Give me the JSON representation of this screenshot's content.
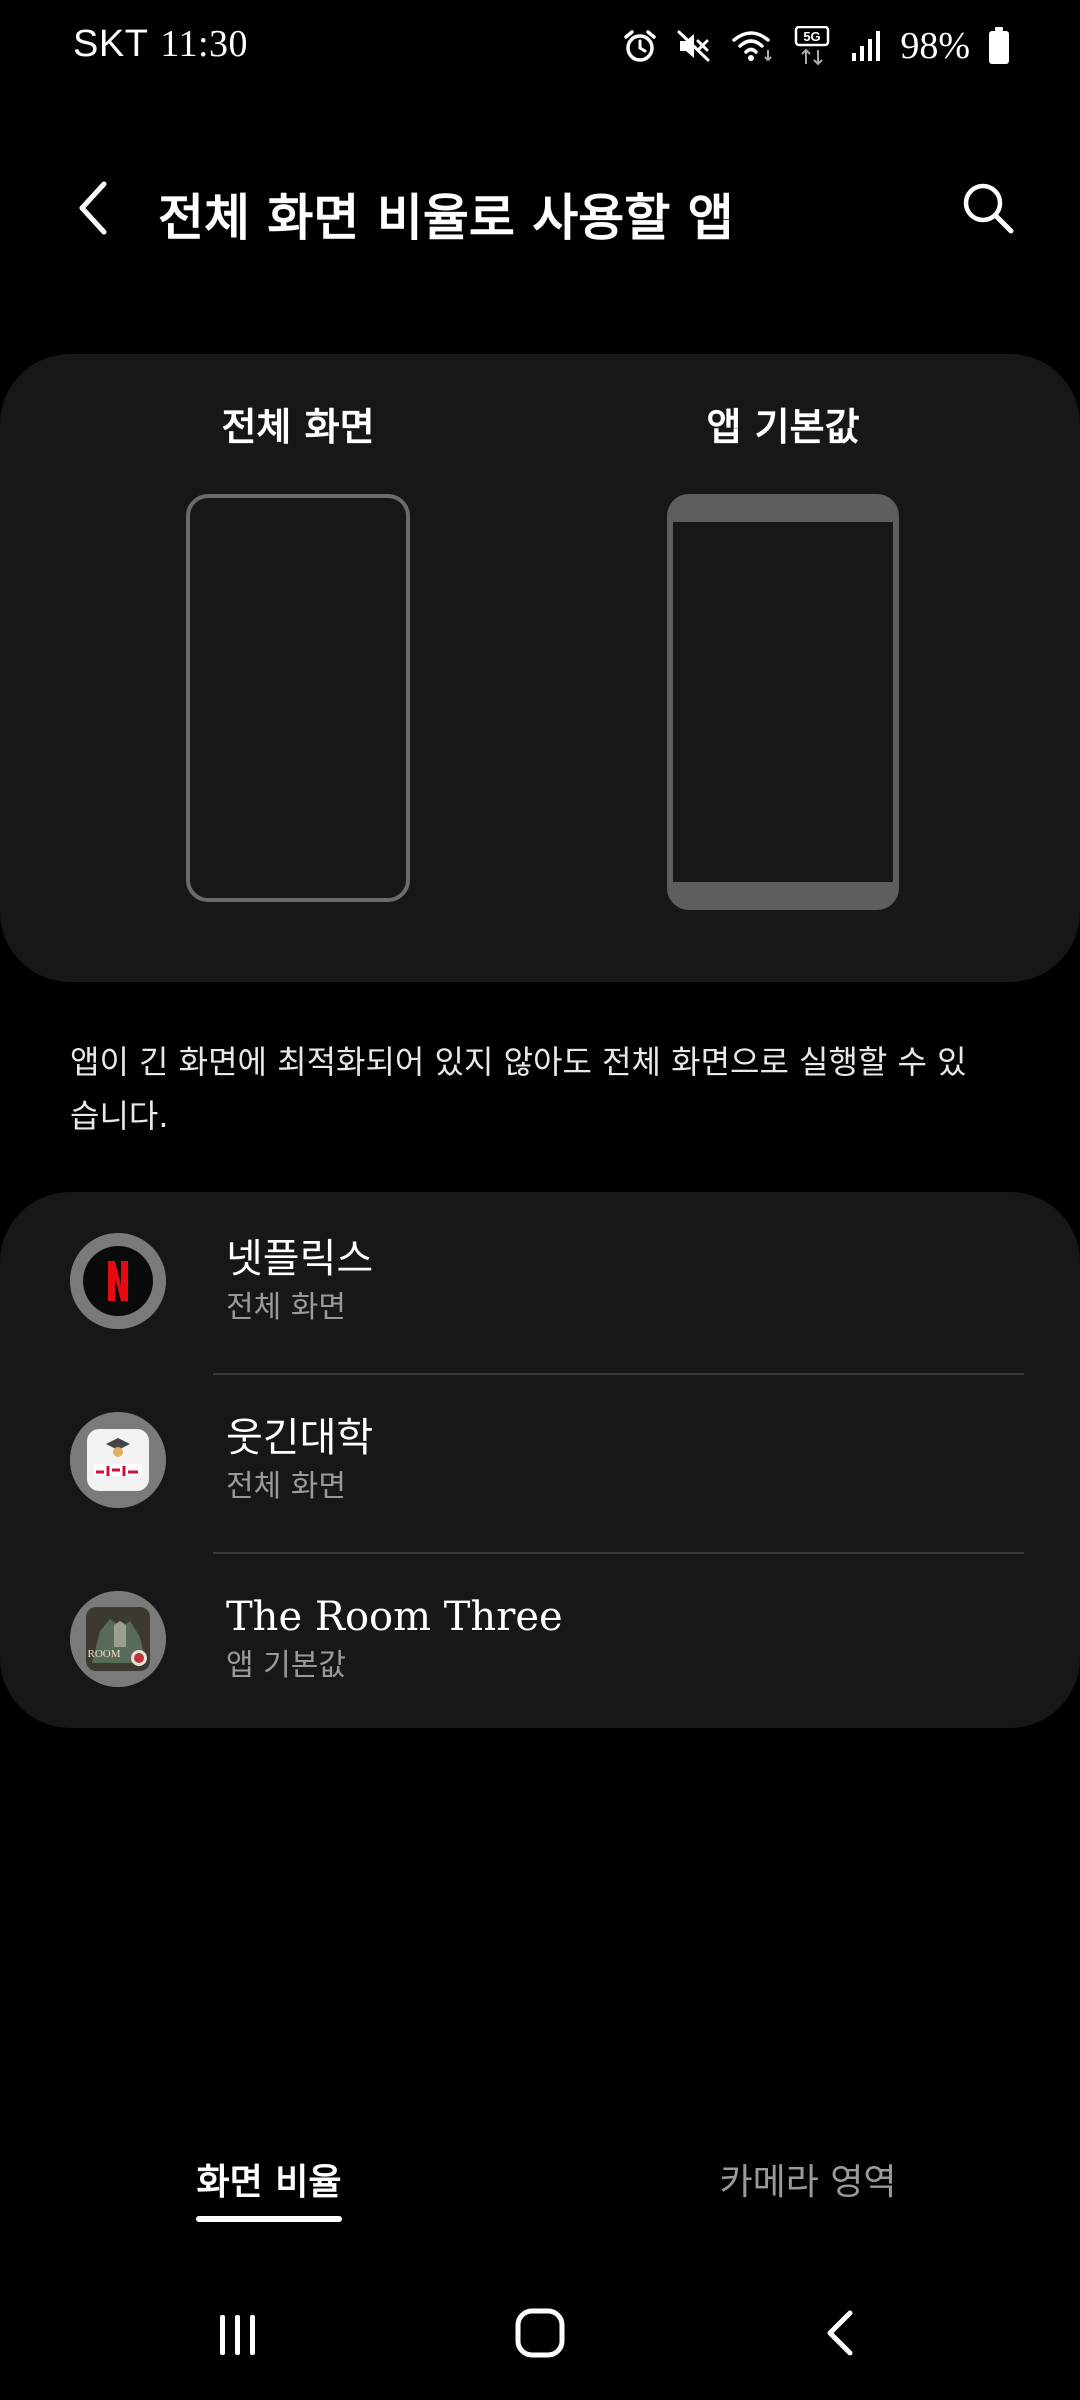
{
  "status_bar": {
    "carrier": "SKT",
    "time": "11:30",
    "battery": "98%",
    "icons": [
      "alarm-icon",
      "mute-icon",
      "wifi-icon",
      "5g-icon",
      "signal-icon",
      "battery-icon"
    ]
  },
  "header": {
    "title": "전체 화면 비율로 사용할 앱",
    "back_icon": "back-arrow-icon",
    "search_icon": "search-icon"
  },
  "preview": {
    "full_screen_label": "전체 화면",
    "app_default_label": "앱 기본값"
  },
  "description": "앱이 긴 화면에 최적화되어 있지 않아도 전체 화면으로 실행할 수 있습니다.",
  "apps": [
    {
      "name": "넷플릭스",
      "mode": "전체 화면",
      "icon": "netflix-icon"
    },
    {
      "name": "웃긴대학",
      "mode": "전체 화면",
      "icon": "humoruniv-icon"
    },
    {
      "name": "The Room Three",
      "mode": "앱 기본값",
      "icon": "the-room-three-icon"
    }
  ],
  "tabs": {
    "active": "화면 비율",
    "inactive": "카메라 영역"
  },
  "colors": {
    "background": "#000000",
    "card": "#171717",
    "secondary_text": "#9a9a9a",
    "netflix_red": "#e50914"
  }
}
